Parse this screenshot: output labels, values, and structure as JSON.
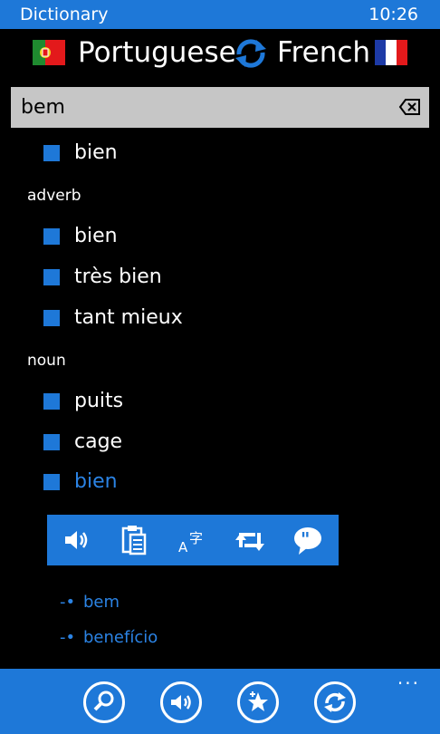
{
  "status": {
    "app_title": "Dictionary",
    "time": "10:26"
  },
  "languages": {
    "source": "Portuguese",
    "target": "French"
  },
  "search": {
    "value": "bem"
  },
  "results": {
    "first": "bien",
    "groups": [
      {
        "pos": "adverb",
        "items": [
          "bien",
          "très bien",
          "tant mieux"
        ]
      },
      {
        "pos": "noun",
        "items": [
          "puits",
          "cage",
          "bien"
        ]
      }
    ]
  },
  "toolbar": {
    "icons": [
      "speaker-icon",
      "clipboard-icon",
      "translate-icon",
      "retweet-icon",
      "quote-icon"
    ]
  },
  "suggestions": [
    "bem",
    "benefício"
  ],
  "appbar": {
    "buttons": [
      "search-icon",
      "speaker-icon",
      "star-add-icon",
      "refresh-icon"
    ],
    "more": "..."
  },
  "colors": {
    "accent": "#1e78d8",
    "link": "#2b83e4",
    "search_bg": "#c6c6c6"
  }
}
